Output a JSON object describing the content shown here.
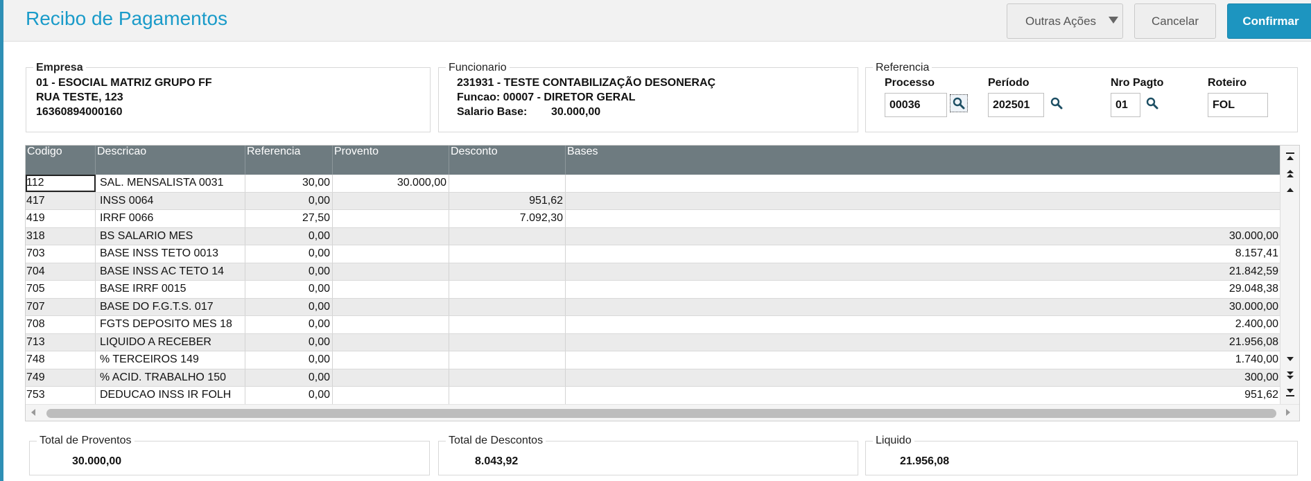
{
  "header": {
    "title": "Recibo de Pagamentos",
    "outras_acoes": "Outras Ações",
    "cancelar": "Cancelar",
    "confirmar": "Confirmar"
  },
  "empresa": {
    "legend": "Empresa",
    "line1": "01 - ESOCIAL MATRIZ GRUPO FF",
    "line2": "RUA TESTE, 123",
    "line3": "16360894000160"
  },
  "funcionario": {
    "legend": "Funcionario",
    "line1": "231931 - TESTE CONTABILIZAÇÃO DESONERAÇ",
    "line2": "Funcao: 00007 - DIRETOR GERAL",
    "salario_label": "Salario Base:",
    "salario_value": "30.000,00"
  },
  "referencia": {
    "legend": "Referencia",
    "processo_label": "Processo",
    "processo_value": "00036",
    "periodo_label": "Período",
    "periodo_value": "202501",
    "nro_pagto_label": "Nro Pagto",
    "nro_pagto_value": "01",
    "roteiro_label": "Roteiro",
    "roteiro_value": "FOL"
  },
  "grid": {
    "columns": [
      "Codigo",
      "Descricao",
      "Referencia",
      "Provento",
      "Desconto",
      "Bases"
    ],
    "rows": [
      [
        "112",
        "SAL. MENSALISTA 0031",
        "30,00",
        "30.000,00",
        "",
        ""
      ],
      [
        "417",
        "INSS 0064",
        "0,00",
        "",
        "951,62",
        ""
      ],
      [
        "419",
        "IRRF 0066",
        "27,50",
        "",
        "7.092,30",
        ""
      ],
      [
        "318",
        "BS SALARIO MES",
        "0,00",
        "",
        "",
        "30.000,00"
      ],
      [
        "703",
        "BASE INSS TETO 0013",
        "0,00",
        "",
        "",
        "8.157,41"
      ],
      [
        "704",
        "BASE INSS AC TETO 14",
        "0,00",
        "",
        "",
        "21.842,59"
      ],
      [
        "705",
        "BASE IRRF 0015",
        "0,00",
        "",
        "",
        "29.048,38"
      ],
      [
        "707",
        "BASE DO F.G.T.S. 017",
        "0,00",
        "",
        "",
        "30.000,00"
      ],
      [
        "708",
        "FGTS DEPOSITO MES 18",
        "0,00",
        "",
        "",
        "2.400,00"
      ],
      [
        "713",
        "LIQUIDO A RECEBER",
        "0,00",
        "",
        "",
        "21.956,08"
      ],
      [
        "748",
        "% TERCEIROS 149",
        "0,00",
        "",
        "",
        "1.740,00"
      ],
      [
        "749",
        "% ACID. TRABALHO 150",
        "0,00",
        "",
        "",
        "300,00"
      ],
      [
        "753",
        "DEDUCAO INSS IR FOLH",
        "0,00",
        "",
        "",
        "951,62"
      ]
    ]
  },
  "totals": {
    "proventos_label": "Total de Proventos",
    "proventos_value": "30.000,00",
    "descontos_label": "Total de Descontos",
    "descontos_value": "8.043,92",
    "liquido_label": "Liquido",
    "liquido_value": "21.956,08"
  },
  "colors": {
    "accent": "#1a9bc9",
    "header_grid": "#6e7b80",
    "confirm_button": "#1d95c0"
  }
}
